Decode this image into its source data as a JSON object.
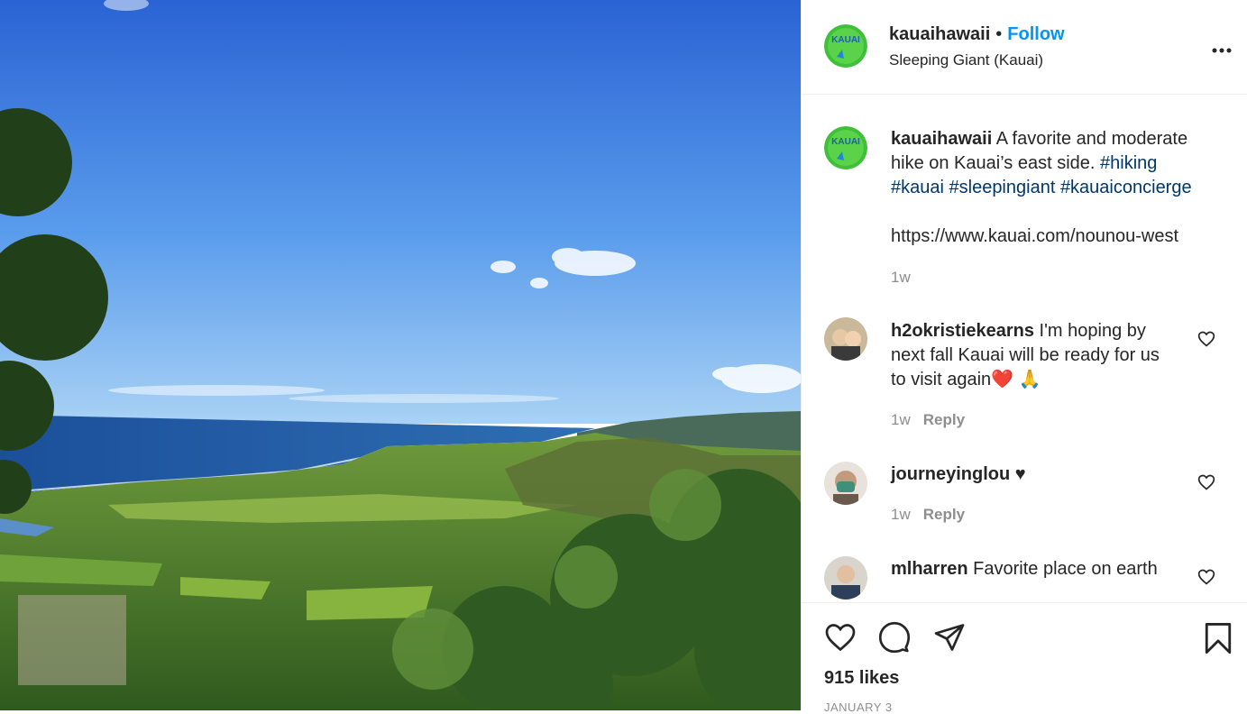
{
  "post": {
    "author": "kauaihawaii",
    "follow_label": "Follow",
    "separator": "•",
    "location": "Sleeping Giant (Kauai)",
    "more_label": "•••",
    "avatar_text": "KAUAI"
  },
  "caption": {
    "username": "kauaihawaii",
    "text_1": " A favorite and moderate hike on Kauai’s east side. ",
    "hashtags": [
      "#hiking",
      "#kauai",
      "#sleepingiant",
      "#kauaiconcierge"
    ],
    "link": "https://www.kauai.com/nounou-west",
    "time": "1w"
  },
  "comments": [
    {
      "username": "h2okristiekearns",
      "text": " I'm hoping by next fall Kauai will be ready for us to visit again❤️ 🙏",
      "time": "1w",
      "reply": "Reply"
    },
    {
      "username": "journeyinglou",
      "text": " ♥",
      "time": "1w",
      "reply": "Reply"
    },
    {
      "username": "mlharren",
      "text": " Favorite place on earth"
    }
  ],
  "footer": {
    "likes": "915 likes",
    "date": "JANUARY 3"
  },
  "icons": [
    "heart-icon",
    "comment-icon",
    "share-icon",
    "bookmark-icon"
  ],
  "colors": {
    "follow": "#0095f6",
    "hashtag": "#00376b",
    "muted": "#8e8e8e",
    "avatar_green": "#3fbf3a",
    "avatar_blue": "#1e88d6"
  }
}
